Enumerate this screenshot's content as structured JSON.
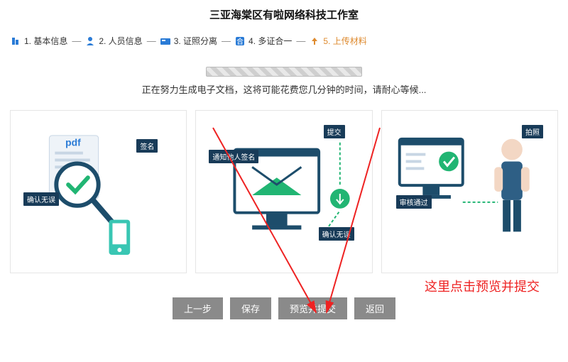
{
  "title": "三亚海棠区有啦网络科技工作室",
  "steps": [
    {
      "label": "1. 基本信息"
    },
    {
      "label": "2. 人员信息"
    },
    {
      "label": "3. 证照分离"
    },
    {
      "label": "4. 多证合一"
    },
    {
      "label": "5. 上传材料",
      "active": true
    }
  ],
  "loading_text": "正在努力生成电子文档，这将可能花费您几分钟的时间，请耐心等候...",
  "card1": {
    "pdf_label": "pdf",
    "tag_sign": "签名",
    "tag_confirm": "确认无误"
  },
  "card2": {
    "tag_submit": "提交",
    "tag_notify": "通知他人签名",
    "tag_confirm": "确认无误"
  },
  "card3": {
    "tag_shoot": "拍照",
    "tag_pass": "审核通过"
  },
  "annotation": "这里点击预览并提交",
  "buttons": {
    "prev": "上一步",
    "save": "保存",
    "preview_submit": "预览并提交",
    "back": "返回"
  }
}
